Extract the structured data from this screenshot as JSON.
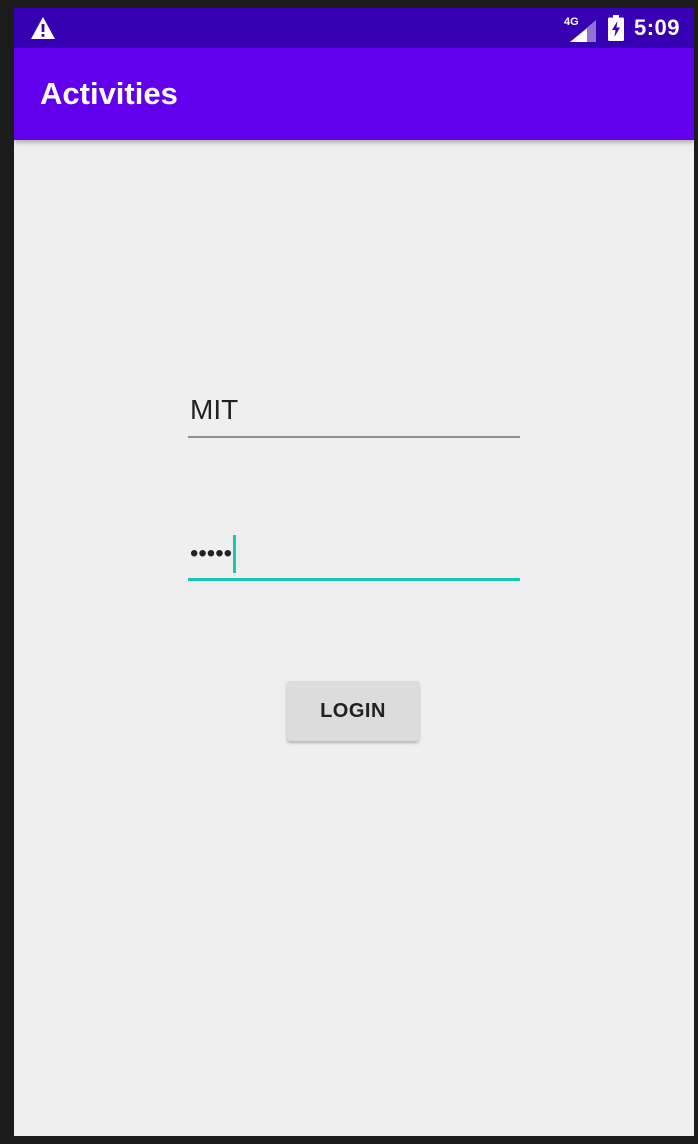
{
  "status_bar": {
    "network_label": "4G",
    "time": "5:09",
    "icons": [
      "warning-icon",
      "signal-icon",
      "battery-charging-icon"
    ],
    "background_color": "#3700b3"
  },
  "app_bar": {
    "title": "Activities",
    "background_color": "#6200ee"
  },
  "form": {
    "username_value": "MIT",
    "password_value": "•••••",
    "login_label": "LOGIN",
    "accent_color": "#19c7b5"
  }
}
